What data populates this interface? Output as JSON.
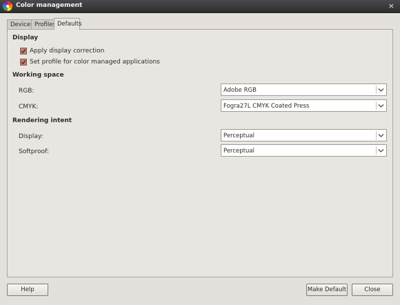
{
  "window": {
    "title": "Color management",
    "close_glyph": "×",
    "icon": "color-wheel-icon"
  },
  "tabs": [
    {
      "label": "Devices"
    },
    {
      "label": "Profiles"
    },
    {
      "label": "Defaults",
      "active": true
    }
  ],
  "display": {
    "heading": "Display",
    "apply_correction": {
      "label": "Apply display correction",
      "checked": true
    },
    "set_profile": {
      "label": "Set profile for color managed applications",
      "checked": true
    }
  },
  "working_space": {
    "heading": "Working space",
    "rgb": {
      "label": "RGB:",
      "value": "Adobe RGB"
    },
    "cmyk": {
      "label": "CMYK:",
      "value": "Fogra27L CMYK Coated Press"
    }
  },
  "rendering_intent": {
    "heading": "Rendering intent",
    "display": {
      "label": "Display:",
      "value": "Perceptual"
    },
    "softproof": {
      "label": "Softproof:",
      "value": "Perceptual"
    }
  },
  "buttons": {
    "help": "Help",
    "make_default": "Make Default",
    "close": "Close"
  },
  "colors": {
    "checkbox": "#c17f6f",
    "titlebar": "#3a3a3a",
    "panel": "#e9e6e1"
  }
}
